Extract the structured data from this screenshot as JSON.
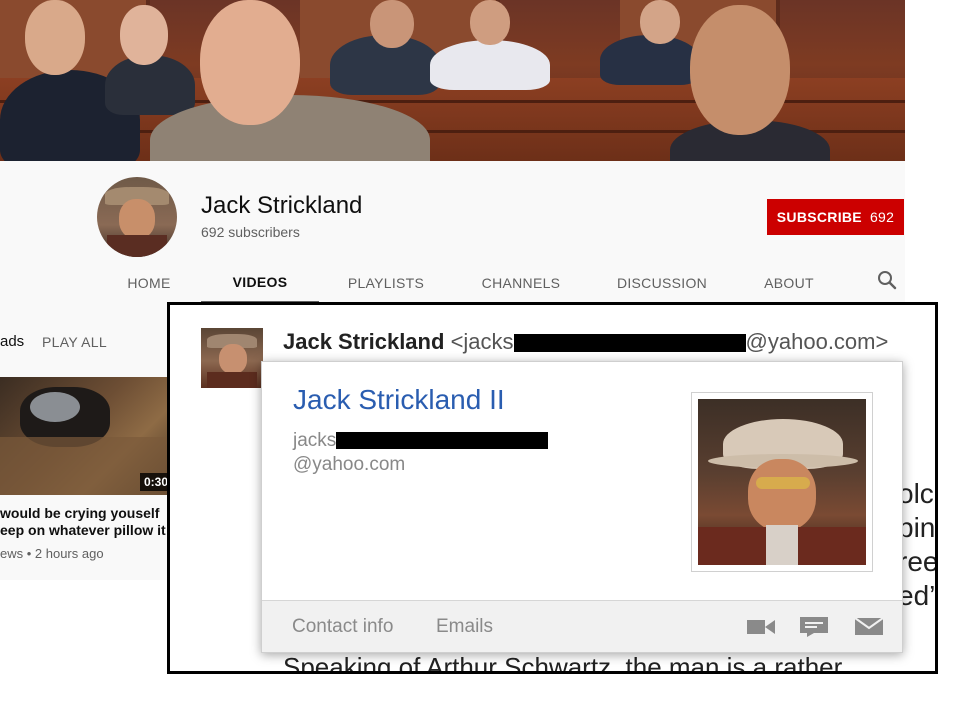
{
  "channel": {
    "name": "Jack Strickland",
    "subscribers": "692 subscribers",
    "subscribe_label": "SUBSCRIBE",
    "subscribe_count": "692"
  },
  "tabs": [
    {
      "label": "HOME"
    },
    {
      "label": "VIDEOS"
    },
    {
      "label": "PLAYLISTS"
    },
    {
      "label": "CHANNELS"
    },
    {
      "label": "DISCUSSION"
    },
    {
      "label": "ABOUT"
    }
  ],
  "active_tab": "VIDEOS",
  "section": {
    "title_fragment": "ads",
    "play_all": "PLAY ALL"
  },
  "video": {
    "duration": "0:30",
    "title_line1": "would be crying youself",
    "title_line2": "eep on whatever pillow it",
    "meta": "ews • 2 hours ago"
  },
  "email": {
    "sender_name": "Jack Strickland",
    "sender_email_prefix": "<jacks",
    "sender_email_suffix": "@yahoo.com>",
    "right_text": [
      "olc",
      "pin",
      "ree",
      "ed’"
    ],
    "bottom_text": "Speaking of Arthur Schwartz, the man is a rather"
  },
  "contact_card": {
    "name": "Jack Strickland II",
    "email_prefix": "jacks",
    "email_domain": "@yahoo.com",
    "footer_links": [
      "Contact info",
      "Emails"
    ],
    "footer_icons": [
      "video-call-icon",
      "chat-icon",
      "mail-icon"
    ]
  },
  "colors": {
    "subscribe": "#cc0000",
    "card_name": "#2a5db0",
    "tab_active": "#0f0f0f",
    "tab_inactive": "#606060"
  }
}
